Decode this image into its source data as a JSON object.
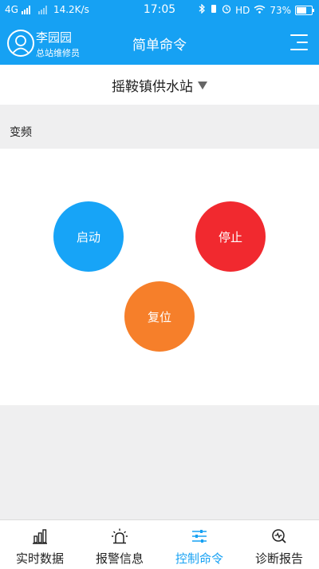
{
  "status_bar": {
    "network": "4G",
    "speed": "14.2K/s",
    "time": "17:05",
    "hd": "HD",
    "battery": "73%",
    "battery_level": 0.73
  },
  "header": {
    "user_name": "李园园",
    "user_role": "总站维修员",
    "title": "简单命令"
  },
  "station": {
    "name": "摇鞍镇供水站"
  },
  "section": {
    "label": "变频"
  },
  "controls": {
    "start": "启动",
    "stop": "停止",
    "reset": "复位"
  },
  "colors": {
    "accent": "#16a1f3",
    "start": "#17a4f7",
    "stop": "#f1292f",
    "reset": "#f67f2a"
  },
  "tabs": [
    {
      "label": "实时数据",
      "icon": "bar-chart-icon"
    },
    {
      "label": "报警信息",
      "icon": "alarm-icon"
    },
    {
      "label": "控制命令",
      "icon": "sliders-icon"
    },
    {
      "label": "诊断报告",
      "icon": "diagnosis-icon"
    }
  ]
}
